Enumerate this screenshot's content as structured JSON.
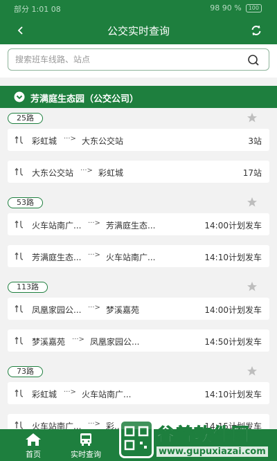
{
  "status_bar": {
    "left_text": "部分 1:01 08",
    "right_text": "98 90 %",
    "battery": "100"
  },
  "header": {
    "title": "公交实时查询",
    "back_icon": "chevron-left-icon",
    "refresh_icon": "refresh-icon"
  },
  "search": {
    "placeholder": "搜索班车线路、站点",
    "value": ""
  },
  "station": {
    "name": "芳满庭生态园（公交公司）"
  },
  "routes": [
    {
      "name": "25路",
      "favorite": false,
      "trips": [
        {
          "from": "彩虹城",
          "to": "大东公交站",
          "info": "3站"
        },
        {
          "from": "大东公交站",
          "to": "彩虹城",
          "info": "17站"
        }
      ]
    },
    {
      "name": "53路",
      "favorite": false,
      "trips": [
        {
          "from": "火车站南广...",
          "to": "芳满庭生态...",
          "info": "14:00计划发车"
        },
        {
          "from": "芳满庭生态...",
          "to": "火车站南广...",
          "info": "14:10计划发车"
        }
      ]
    },
    {
      "name": "113路",
      "favorite": false,
      "trips": [
        {
          "from": "凤凰家园公...",
          "to": "梦溪嘉苑",
          "info": "14:00计划发车"
        },
        {
          "from": "梦溪嘉苑",
          "to": "凤凰家园公...",
          "info": "14:50计划发车"
        }
      ]
    },
    {
      "name": "73路",
      "favorite": false,
      "trips": [
        {
          "from": "彩虹城",
          "to": "火车站南广...",
          "info": "14:10计划发车"
        },
        {
          "from": "火车站南广...",
          "to": "彩...",
          "info": "14:15计划发车"
        }
      ]
    }
  ],
  "arrow_text": "···>",
  "tabs": [
    {
      "label": "首页",
      "icon": "home-icon"
    },
    {
      "label": "实时查询",
      "icon": "bus-icon"
    }
  ],
  "watermark": {
    "title": "谷普软件园",
    "url": "www.gupuxiazai.com"
  },
  "colors": {
    "brand_green": "#1e7f3e",
    "background": "#f2f2f2"
  }
}
